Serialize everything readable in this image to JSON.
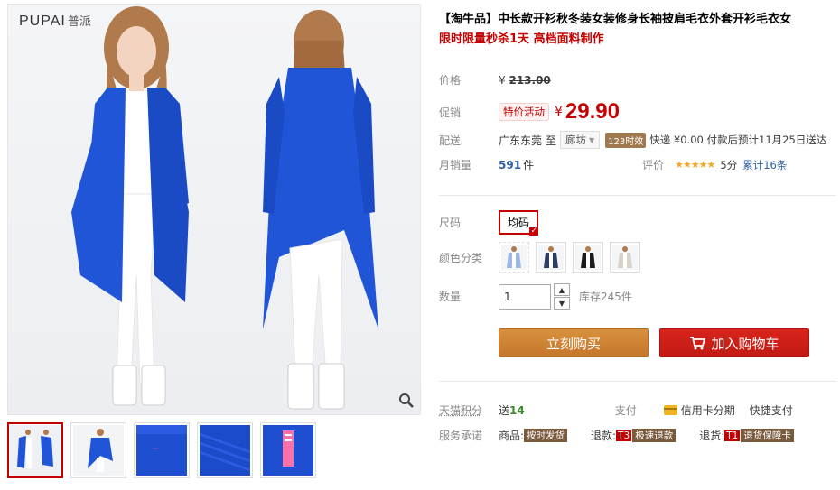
{
  "brand": {
    "name": "PUPAI",
    "name_cn": "普派"
  },
  "product": {
    "title": "【淘牛品】中长款开衫秋冬装女装修身长袖披肩毛衣外套开衫毛衣女",
    "subtitle": "限时限量秒杀1天 高档面料制作"
  },
  "price": {
    "label": "价格",
    "original_symbol": "¥",
    "original": "213.00",
    "promo_label": "促销",
    "promo_tag": "特价活动",
    "symbol": "¥",
    "current": "29.90"
  },
  "shipping": {
    "label": "配送",
    "from": "广东东莞",
    "to_word": "至",
    "to_city": "廊坊",
    "days_badge": "123时效",
    "text": "快递 ¥0.00 付款后预计11月25日送达"
  },
  "sales": {
    "label": "月销量",
    "count": "591",
    "unit": "件",
    "rating_label": "评价",
    "stars": "★★★★★",
    "score": "5分",
    "review_count": "累计16条"
  },
  "options": {
    "size_label": "尺码",
    "size_value": "均码",
    "color_label": "颜色分类",
    "color_count": 4
  },
  "quantity": {
    "label": "数量",
    "value": "1",
    "stock": "库存245件"
  },
  "actions": {
    "buy_now": "立刻购买",
    "add_cart": "加入购物车"
  },
  "extras": {
    "points_label": "天猫积分",
    "points_prefix": "送",
    "points_value": "14",
    "pay_label": "支付",
    "credit_card": "信用卡分期",
    "quick_pay": "快捷支付",
    "service_label": "服务承诺",
    "goods_prefix": "商品:",
    "goods_tag": "按时发货",
    "refund_prefix": "退款:",
    "refund_code": "T3",
    "refund_tag": "极速退款",
    "return_prefix": "退货:",
    "return_code": "T1",
    "return_tag": "退货保障卡"
  },
  "colors": {
    "accent": "#c40000",
    "garment": "#1f55d6",
    "buy_button": "#cc7f33"
  }
}
